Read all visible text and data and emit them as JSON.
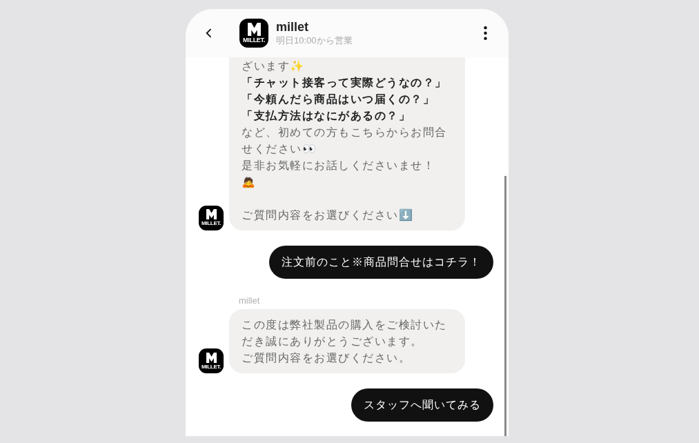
{
  "header": {
    "title": "millet",
    "subtitle": "明日10:00から営業",
    "avatar_label": "MILLET."
  },
  "messages": [
    {
      "kind": "bot",
      "lines": [
        "ざいます✨",
        "**「チャット接客って実際どうなの？」**",
        "**「今頼んだら商品はいつ届くの？」**",
        "**「支払方法はなにがあるの？」**",
        "など、初めての方もこちらからお問合せください👀",
        "是非お気軽にお話しくださいませ！",
        "🙇",
        "ご質問内容をお選びください⬇️"
      ],
      "avatar_label": "MILLET."
    },
    {
      "kind": "user",
      "text": "注文前のこと※商品問合せはコチラ！"
    },
    {
      "kind": "bot",
      "sender": "millet",
      "lines": [
        "この度は弊社製品の購入をご検討いただき誠にありがとうございます。",
        "ご質問内容をお選びください。"
      ],
      "avatar_label": "MILLET."
    },
    {
      "kind": "user",
      "text": "スタッフへ聞いてみる"
    }
  ]
}
